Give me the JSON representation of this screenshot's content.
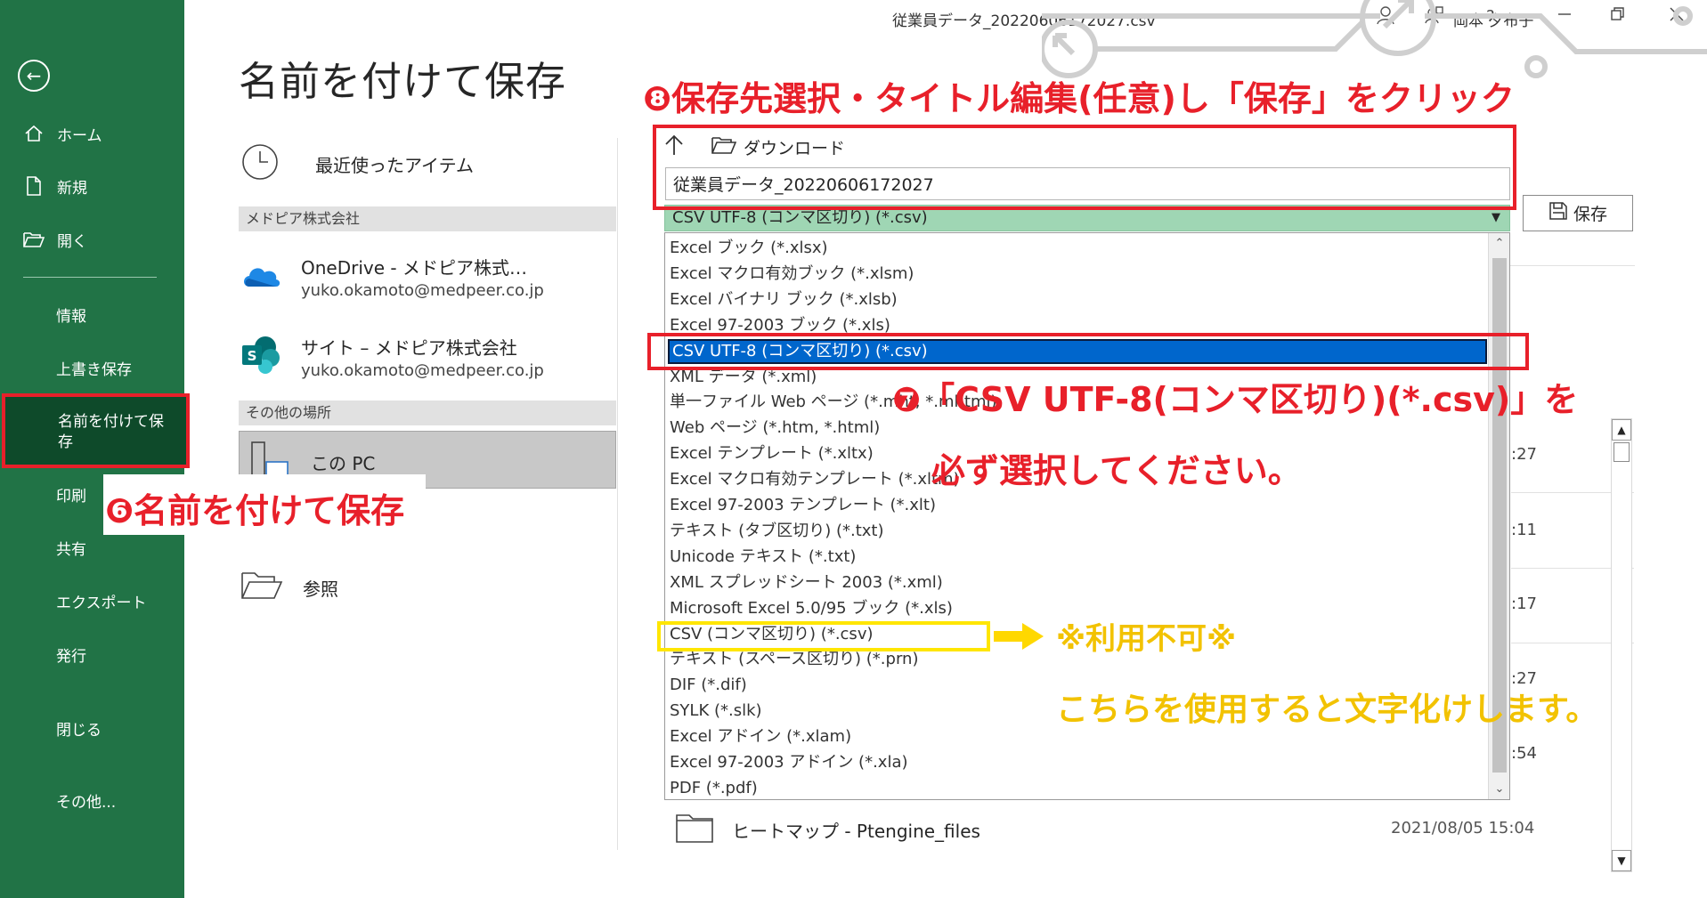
{
  "window": {
    "title": "従業員データ_20220606172027.csv",
    "user": "岡本 夕布子",
    "help": "?"
  },
  "sidebar": {
    "items": [
      {
        "label": "ホーム",
        "icon": "home-icon"
      },
      {
        "label": "新規",
        "icon": "new-file-icon"
      },
      {
        "label": "開く",
        "icon": "open-folder-icon"
      },
      {
        "label": "情報"
      },
      {
        "label": "上書き保存"
      },
      {
        "label": "名前を付けて保存"
      },
      {
        "label": "印刷"
      },
      {
        "label": "共有"
      },
      {
        "label": "エクスポート"
      },
      {
        "label": "発行"
      },
      {
        "label": "閉じる"
      },
      {
        "label": "その他..."
      }
    ]
  },
  "page": {
    "title": "名前を付けて保存",
    "recent": "最近使ったアイテム",
    "org_section": "メドピア株式会社",
    "onedrive": {
      "name": "OneDrive - メドピア株式…",
      "email": "yuko.okamoto@medpeer.co.jp"
    },
    "site": {
      "name": "サイト – メドピア株式会社",
      "email": "yuko.okamoto@medpeer.co.jp"
    },
    "other_section": "その他の場所",
    "this_pc": "この PC",
    "browse": "参照"
  },
  "save": {
    "folder": "ダウンロード",
    "filename": "従業員データ_20220606172027",
    "selected_type": "CSV UTF-8 (コンマ区切り) (*.csv)",
    "save_label": "保存",
    "file_types": [
      "Excel ブック (*.xlsx)",
      "Excel マクロ有効ブック (*.xlsm)",
      "Excel バイナリ ブック (*.xlsb)",
      "Excel 97-2003 ブック (*.xls)",
      "CSV UTF-8 (コンマ区切り) (*.csv)",
      "XML データ (*.xml)",
      "単一ファイル Web ページ (*.mht, *.mhtml)",
      "Web ページ (*.htm, *.html)",
      "Excel テンプレート (*.xltx)",
      "Excel マクロ有効テンプレート (*.xltm)",
      "Excel 97-2003 テンプレート (*.xlt)",
      "テキスト (タブ区切り) (*.txt)",
      "Unicode テキスト (*.txt)",
      "XML スプレッドシート 2003 (*.xml)",
      "Microsoft Excel 5.0/95 ブック (*.xls)",
      "CSV (コンマ区切り) (*.csv)",
      "テキスト (スペース区切り) (*.prn)",
      "DIF (*.dif)",
      "SYLK (*.slk)",
      "Excel アドイン (*.xlam)",
      "Excel 97-2003 アドイン (*.xla)",
      "PDF (*.pdf)"
    ],
    "time_fragments": [
      ":27",
      ":11",
      ":17",
      ":27",
      ":54"
    ],
    "file_row": {
      "name": "ヒートマップ - Ptengine_files",
      "date": "2021/08/05 15:04"
    }
  },
  "annotations": {
    "step6": "❻名前を付けて保存",
    "step7_line1": "❼「CSV UTF-8(コンマ区切り)(*.csv)」を",
    "step7_line2": "必ず選択してください。",
    "step8": "❽保存先選択・タイトル編集(任意)し「保存」をクリック",
    "warn1": "※利用不可※",
    "warn2": "こちらを使用すると文字化けします。"
  },
  "colors": {
    "sidebar_green": "#217346",
    "annotation_red": "#e8202a",
    "annotation_yellow": "#f2c200",
    "selection_blue": "#0066cc"
  }
}
